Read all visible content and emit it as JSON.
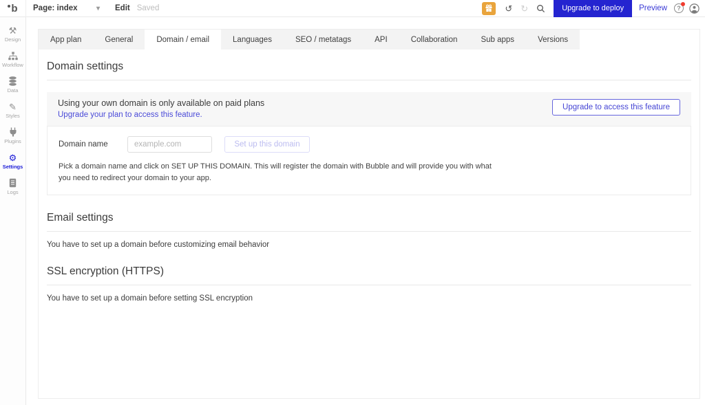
{
  "topbar": {
    "logo_letter": "b",
    "page_label": "Page: index",
    "edit_label": "Edit",
    "saved_label": "Saved",
    "deploy_label": "Upgrade to deploy",
    "preview_label": "Preview"
  },
  "icons": {
    "caret": "▾",
    "design": "⚒",
    "styles": "✎",
    "settings": "⚙",
    "undo": "↺",
    "redo": "↻",
    "help": "?"
  },
  "sidebar": {
    "items": [
      {
        "label": "Design",
        "icon": "design-tools-icon"
      },
      {
        "label": "Workflow",
        "icon": "workflow-icon"
      },
      {
        "label": "Data",
        "icon": "database-icon"
      },
      {
        "label": "Styles",
        "icon": "paintbrush-icon"
      },
      {
        "label": "Plugins",
        "icon": "plug-icon"
      },
      {
        "label": "Settings",
        "icon": "gear-icon",
        "active": true
      },
      {
        "label": "Logs",
        "icon": "logs-icon"
      }
    ]
  },
  "tabs": [
    {
      "label": "App plan"
    },
    {
      "label": "General"
    },
    {
      "label": "Domain / email",
      "active": true
    },
    {
      "label": "Languages"
    },
    {
      "label": "SEO / metatags"
    },
    {
      "label": "API"
    },
    {
      "label": "Collaboration"
    },
    {
      "label": "Sub apps"
    },
    {
      "label": "Versions"
    }
  ],
  "domain_section": {
    "title": "Domain settings",
    "notice": {
      "text": "Using your own domain is only available on paid plans",
      "link": "Upgrade your plan to access this feature.",
      "button": "Upgrade to access this feature"
    },
    "setup": {
      "label": "Domain name",
      "placeholder": "example.com",
      "button": "Set up this domain",
      "description": "Pick a domain name and click on SET UP THIS DOMAIN. This will register the domain with Bubble and will provide you with what you need to redirect your domain to your app."
    }
  },
  "email_section": {
    "title": "Email settings",
    "message": "You have to set up a domain before customizing email behavior"
  },
  "ssl_section": {
    "title": "SSL encryption (HTTPS)",
    "message": "You have to set up a domain before setting SSL encryption"
  },
  "colors": {
    "accent_blue": "#2424d0",
    "link_blue": "#4a4ad8",
    "active_sidebar_blue": "#1b1bd7",
    "gift_amber": "#e9a43c",
    "notification_red": "#f03b2e"
  }
}
